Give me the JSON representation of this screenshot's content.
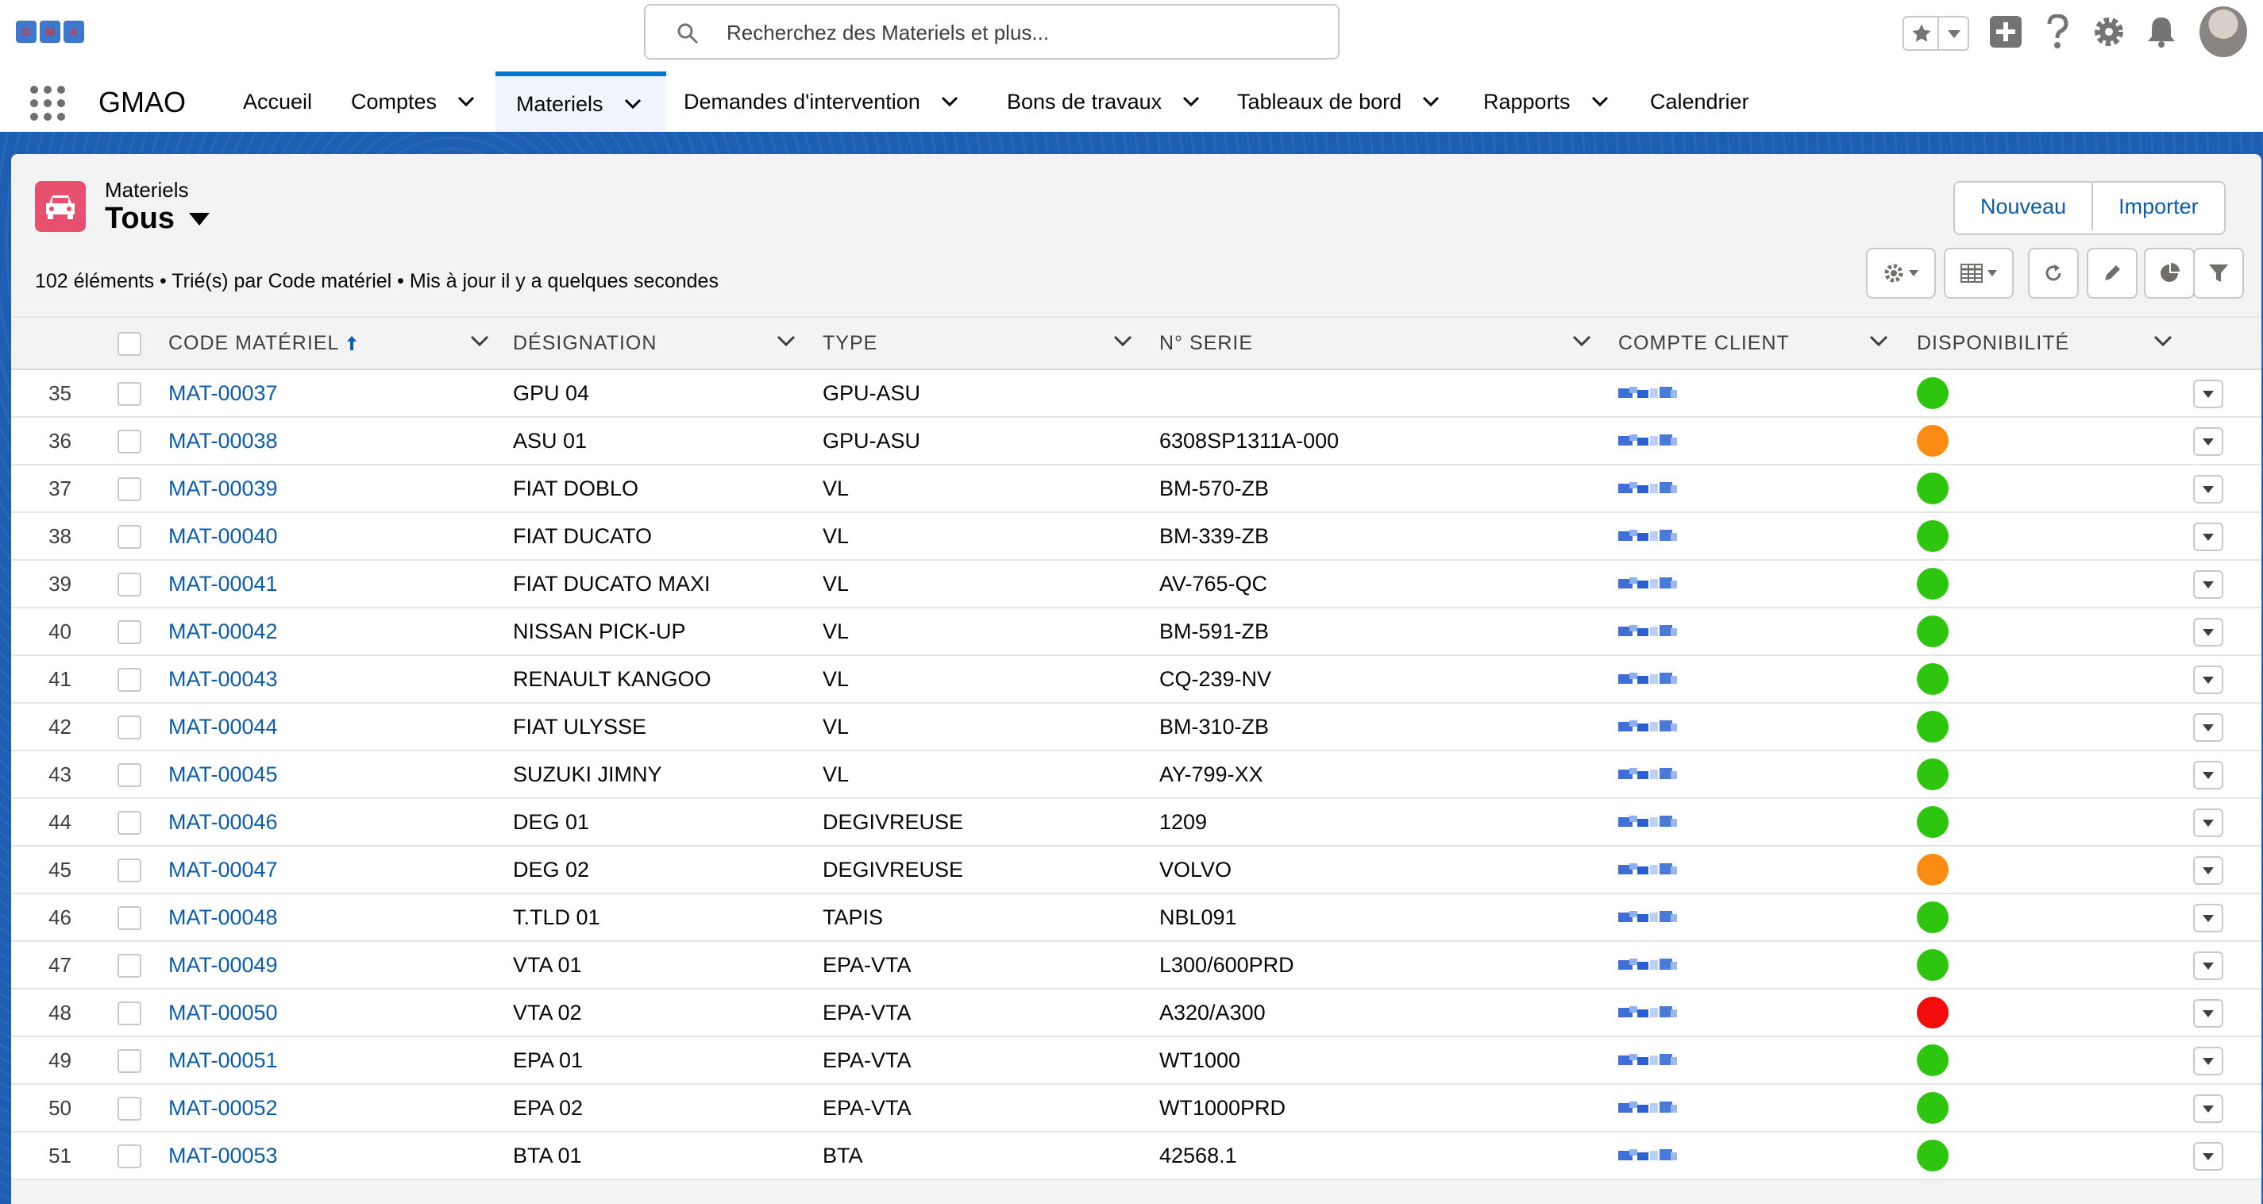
{
  "logo_letters": [
    "D",
    "M",
    "A"
  ],
  "search": {
    "placeholder": "Recherchez des Materiels et plus..."
  },
  "app": {
    "name": "GMAO"
  },
  "nav": [
    {
      "label": "Accueil",
      "has_menu": false,
      "active": false
    },
    {
      "label": "Comptes",
      "has_menu": true,
      "active": false
    },
    {
      "label": "Materiels",
      "has_menu": true,
      "active": true
    },
    {
      "label": "Demandes d'intervention",
      "has_menu": true,
      "active": false
    },
    {
      "label": "Bons de travaux",
      "has_menu": true,
      "active": false
    },
    {
      "label": "Tableaux de bord",
      "has_menu": true,
      "active": false
    },
    {
      "label": "Rapports",
      "has_menu": true,
      "active": false
    },
    {
      "label": "Calendrier",
      "has_menu": false,
      "active": false
    }
  ],
  "list": {
    "object_label": "Materiels",
    "view_name": "Tous",
    "info": "102 éléments • Trié(s) par Code matériel • Mis à jour il y a quelques secondes",
    "buttons": {
      "new": "Nouveau",
      "import": "Importer"
    }
  },
  "columns": [
    {
      "label": "Code matériel",
      "sorted": "asc"
    },
    {
      "label": "Désignation"
    },
    {
      "label": "Type"
    },
    {
      "label": "N° Serie"
    },
    {
      "label": "Compte client"
    },
    {
      "label": "Disponibilité"
    }
  ],
  "colors": {
    "available": "#2ec50f",
    "partial": "#fb8c13",
    "unavailable": "#f20c0c",
    "link": "#0b5cab",
    "brand": "#0176d3"
  },
  "rows": [
    {
      "num": "35",
      "code": "MAT-00037",
      "designation": "GPU 04",
      "type": "GPU-ASU",
      "serie": "",
      "status": "available"
    },
    {
      "num": "36",
      "code": "MAT-00038",
      "designation": "ASU 01",
      "type": "GPU-ASU",
      "serie": "6308SP1311A-000",
      "status": "partial"
    },
    {
      "num": "37",
      "code": "MAT-00039",
      "designation": "FIAT DOBLO",
      "type": "VL",
      "serie": "BM-570-ZB",
      "status": "available"
    },
    {
      "num": "38",
      "code": "MAT-00040",
      "designation": "FIAT DUCATO",
      "type": "VL",
      "serie": "BM-339-ZB",
      "status": "available"
    },
    {
      "num": "39",
      "code": "MAT-00041",
      "designation": "FIAT DUCATO MAXI",
      "type": "VL",
      "serie": "AV-765-QC",
      "status": "available"
    },
    {
      "num": "40",
      "code": "MAT-00042",
      "designation": "NISSAN PICK-UP",
      "type": "VL",
      "serie": "BM-591-ZB",
      "status": "available"
    },
    {
      "num": "41",
      "code": "MAT-00043",
      "designation": "RENAULT KANGOO",
      "type": "VL",
      "serie": "CQ-239-NV",
      "status": "available"
    },
    {
      "num": "42",
      "code": "MAT-00044",
      "designation": "FIAT ULYSSE",
      "type": "VL",
      "serie": "BM-310-ZB",
      "status": "available"
    },
    {
      "num": "43",
      "code": "MAT-00045",
      "designation": "SUZUKI JIMNY",
      "type": "VL",
      "serie": "AY-799-XX",
      "status": "available"
    },
    {
      "num": "44",
      "code": "MAT-00046",
      "designation": "DEG 01",
      "type": "DEGIVREUSE",
      "serie": "1209",
      "status": "available"
    },
    {
      "num": "45",
      "code": "MAT-00047",
      "designation": "DEG 02",
      "type": "DEGIVREUSE",
      "serie": "VOLVO",
      "status": "partial"
    },
    {
      "num": "46",
      "code": "MAT-00048",
      "designation": "T.TLD 01",
      "type": "TAPIS",
      "serie": "NBL091",
      "status": "available"
    },
    {
      "num": "47",
      "code": "MAT-00049",
      "designation": "VTA 01",
      "type": "EPA-VTA",
      "serie": "L300/600PRD",
      "status": "available"
    },
    {
      "num": "48",
      "code": "MAT-00050",
      "designation": "VTA 02",
      "type": "EPA-VTA",
      "serie": "A320/A300",
      "status": "unavailable"
    },
    {
      "num": "49",
      "code": "MAT-00051",
      "designation": "EPA 01",
      "type": "EPA-VTA",
      "serie": "WT1000",
      "status": "available"
    },
    {
      "num": "50",
      "code": "MAT-00052",
      "designation": "EPA 02",
      "type": "EPA-VTA",
      "serie": "WT1000PRD",
      "status": "available"
    },
    {
      "num": "51",
      "code": "MAT-00053",
      "designation": "BTA 01",
      "type": "BTA",
      "serie": "42568.1",
      "status": "available"
    }
  ]
}
